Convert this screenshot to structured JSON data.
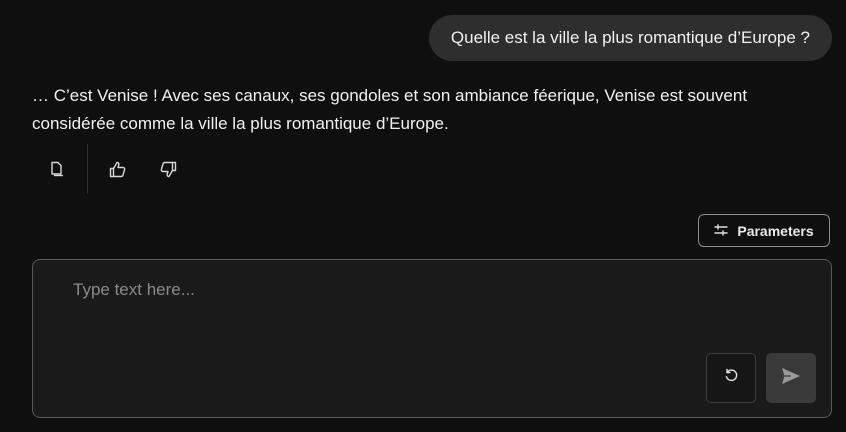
{
  "conversation": {
    "user_message": "Quelle est la ville la plus romantique d’Europe ?",
    "assistant_message": "… C’est Venise ! Avec ses canaux, ses gondoles et son ambiance féerique, Venise est souvent considérée comme la ville la plus romantique d’Europe."
  },
  "message_actions": {
    "icons": [
      "copy-icon",
      "thumbs-up-icon",
      "thumbs-down-icon"
    ]
  },
  "parameters_button": {
    "label": "Parameters",
    "icon": "sliders-icon"
  },
  "composer": {
    "placeholder": "Type text here...",
    "value": "",
    "reset_icon": "reset-icon",
    "send_icon": "send-icon"
  },
  "colors": {
    "background": "#0f0f0f",
    "user_bubble": "#2e2e2e",
    "composer_background": "#1a1a1a",
    "send_button": "#3a3a3a"
  }
}
